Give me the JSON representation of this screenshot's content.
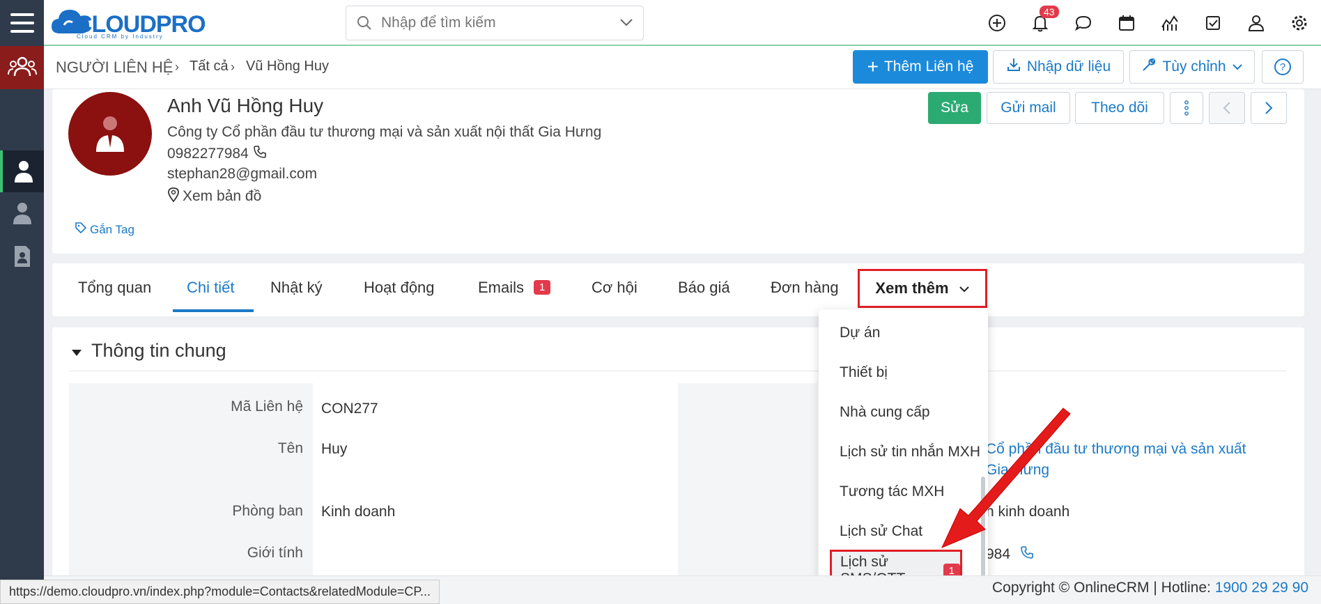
{
  "topbar": {
    "logo_text": "CLOUDPRO",
    "logo_sub": "Cloud CRM by Industry",
    "search_placeholder": "Nhập để tìm kiếm",
    "notification_count": "43",
    "icons": [
      "plus-circle-icon",
      "bell-icon",
      "chat-icon",
      "calendar-icon",
      "chart-icon",
      "checkbox-icon",
      "user-icon",
      "gear-icon"
    ]
  },
  "breadcrumb": {
    "module": "NGƯỜI LIÊN HỆ",
    "all": "Tất cả",
    "current": "Vũ Hồng Huy"
  },
  "actions": {
    "add_contact": "Thêm Liên hệ",
    "import": "Nhập dữ liệu",
    "customize": "Tùy chỉnh",
    "help": "?"
  },
  "profile": {
    "name": "Anh Vũ Hồng Huy",
    "company": "Công ty Cổ phần đầu tư thương mại và sản xuất nội thất Gia Hưng",
    "phone": "0982277984",
    "email": "stephan28@gmail.com",
    "map": "Xem bản đồ",
    "tag": "Gắn Tag",
    "edit": "Sửa",
    "send_mail": "Gửi mail",
    "follow": "Theo dõi"
  },
  "tabs": {
    "overview": "Tổng quan",
    "detail": "Chi tiết",
    "log": "Nhật ký",
    "activity": "Hoạt động",
    "emails": "Emails",
    "emails_badge": "1",
    "opportunity": "Cơ hội",
    "quote": "Báo giá",
    "order": "Đơn hàng",
    "more": "Xem thêm"
  },
  "dropdown": {
    "items": [
      "Dự án",
      "Thiết bị",
      "Nhà cung cấp",
      "Lịch sử tin nhắn MXH",
      "Tương tác MXH",
      "Lịch sử Chat"
    ],
    "last": "Lịch sử SMS/OTT",
    "last_badge": "1"
  },
  "section": {
    "title": "Thông tin chung",
    "fields": {
      "code_label": "Mã Liên hệ",
      "code": "CON277",
      "name_label": "Tên",
      "name": "Huy",
      "dept_label": "Phòng ban",
      "dept": "Kinh doanh",
      "gender_label": "Giới tính"
    },
    "right": {
      "company_line1": "Cổ phần đầu tư thương mại và sản xuất",
      "company_line2": "Gia Hưng",
      "role": "n kinh doanh",
      "phone": "984"
    }
  },
  "footer": {
    "status_url": "https://demo.cloudpro.vn/index.php?module=Contacts&relatedModule=CP...",
    "copyright": "Copyright © OnlineCRM | Hotline:",
    "hotline": "1900 29 29 90"
  }
}
